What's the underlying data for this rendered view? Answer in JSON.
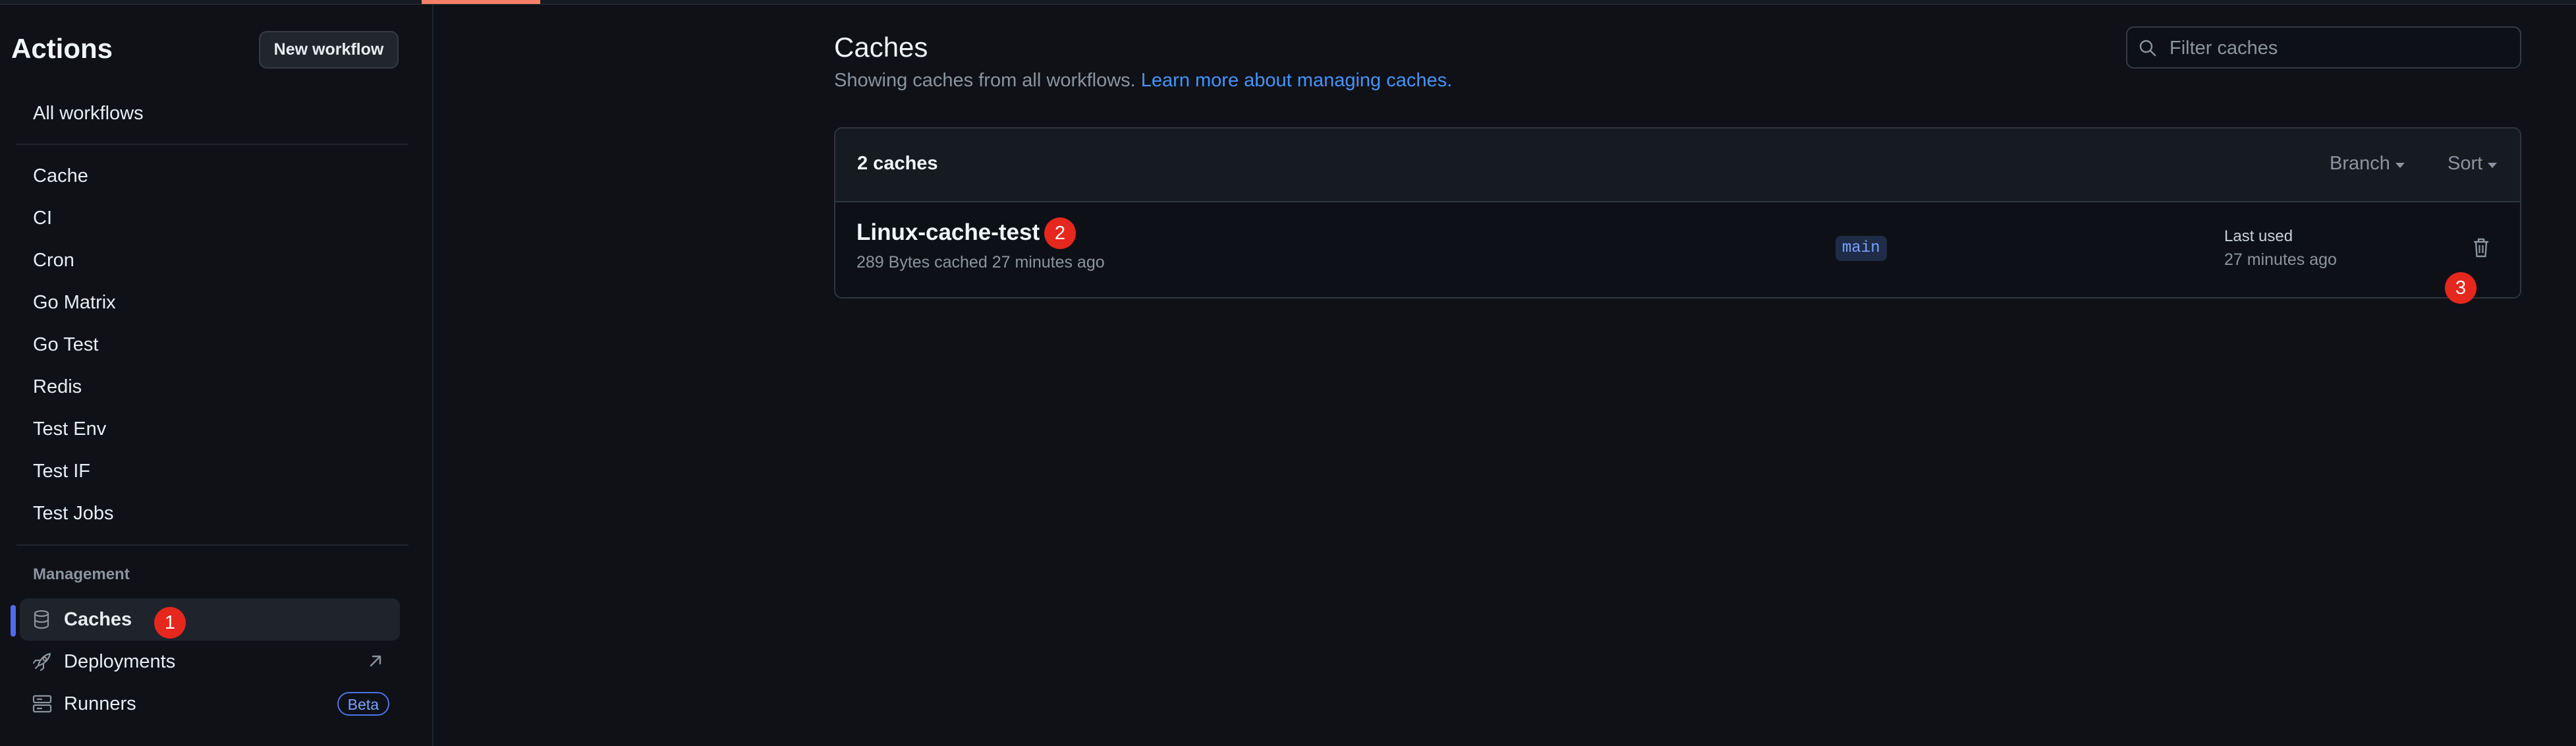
{
  "sidebar": {
    "title": "Actions",
    "new_workflow_label": "New workflow",
    "all_workflows": "All workflows",
    "workflows": [
      "Cache",
      "CI",
      "Cron",
      "Go Matrix",
      "Go Test",
      "Redis",
      "Test Env",
      "Test IF",
      "Test Jobs"
    ],
    "management_heading": "Management",
    "management_items": [
      {
        "label": "Caches",
        "icon": "database-icon",
        "active": true
      },
      {
        "label": "Deployments",
        "icon": "rocket-icon",
        "external": true
      },
      {
        "label": "Runners",
        "icon": "server-icon",
        "badge": "Beta"
      }
    ]
  },
  "main": {
    "title": "Caches",
    "subtitle": "Showing caches from all workflows.",
    "learn_more": "Learn more about managing caches.",
    "filter_placeholder": "Filter caches",
    "count_label": "2 caches",
    "branch_filter": "Branch",
    "sort_filter": "Sort",
    "caches": [
      {
        "name": "Linux-cache-test",
        "meta": "289 Bytes cached 27 minutes ago",
        "branch": "main",
        "last_used_label": "Last used",
        "last_used": "27 minutes ago"
      }
    ]
  },
  "annotations": [
    "1",
    "2",
    "3"
  ],
  "colors": {
    "accent": "#4f6bed",
    "link": "#4493f8",
    "badge": "#e5271e",
    "tab_accent": "#f78166"
  }
}
